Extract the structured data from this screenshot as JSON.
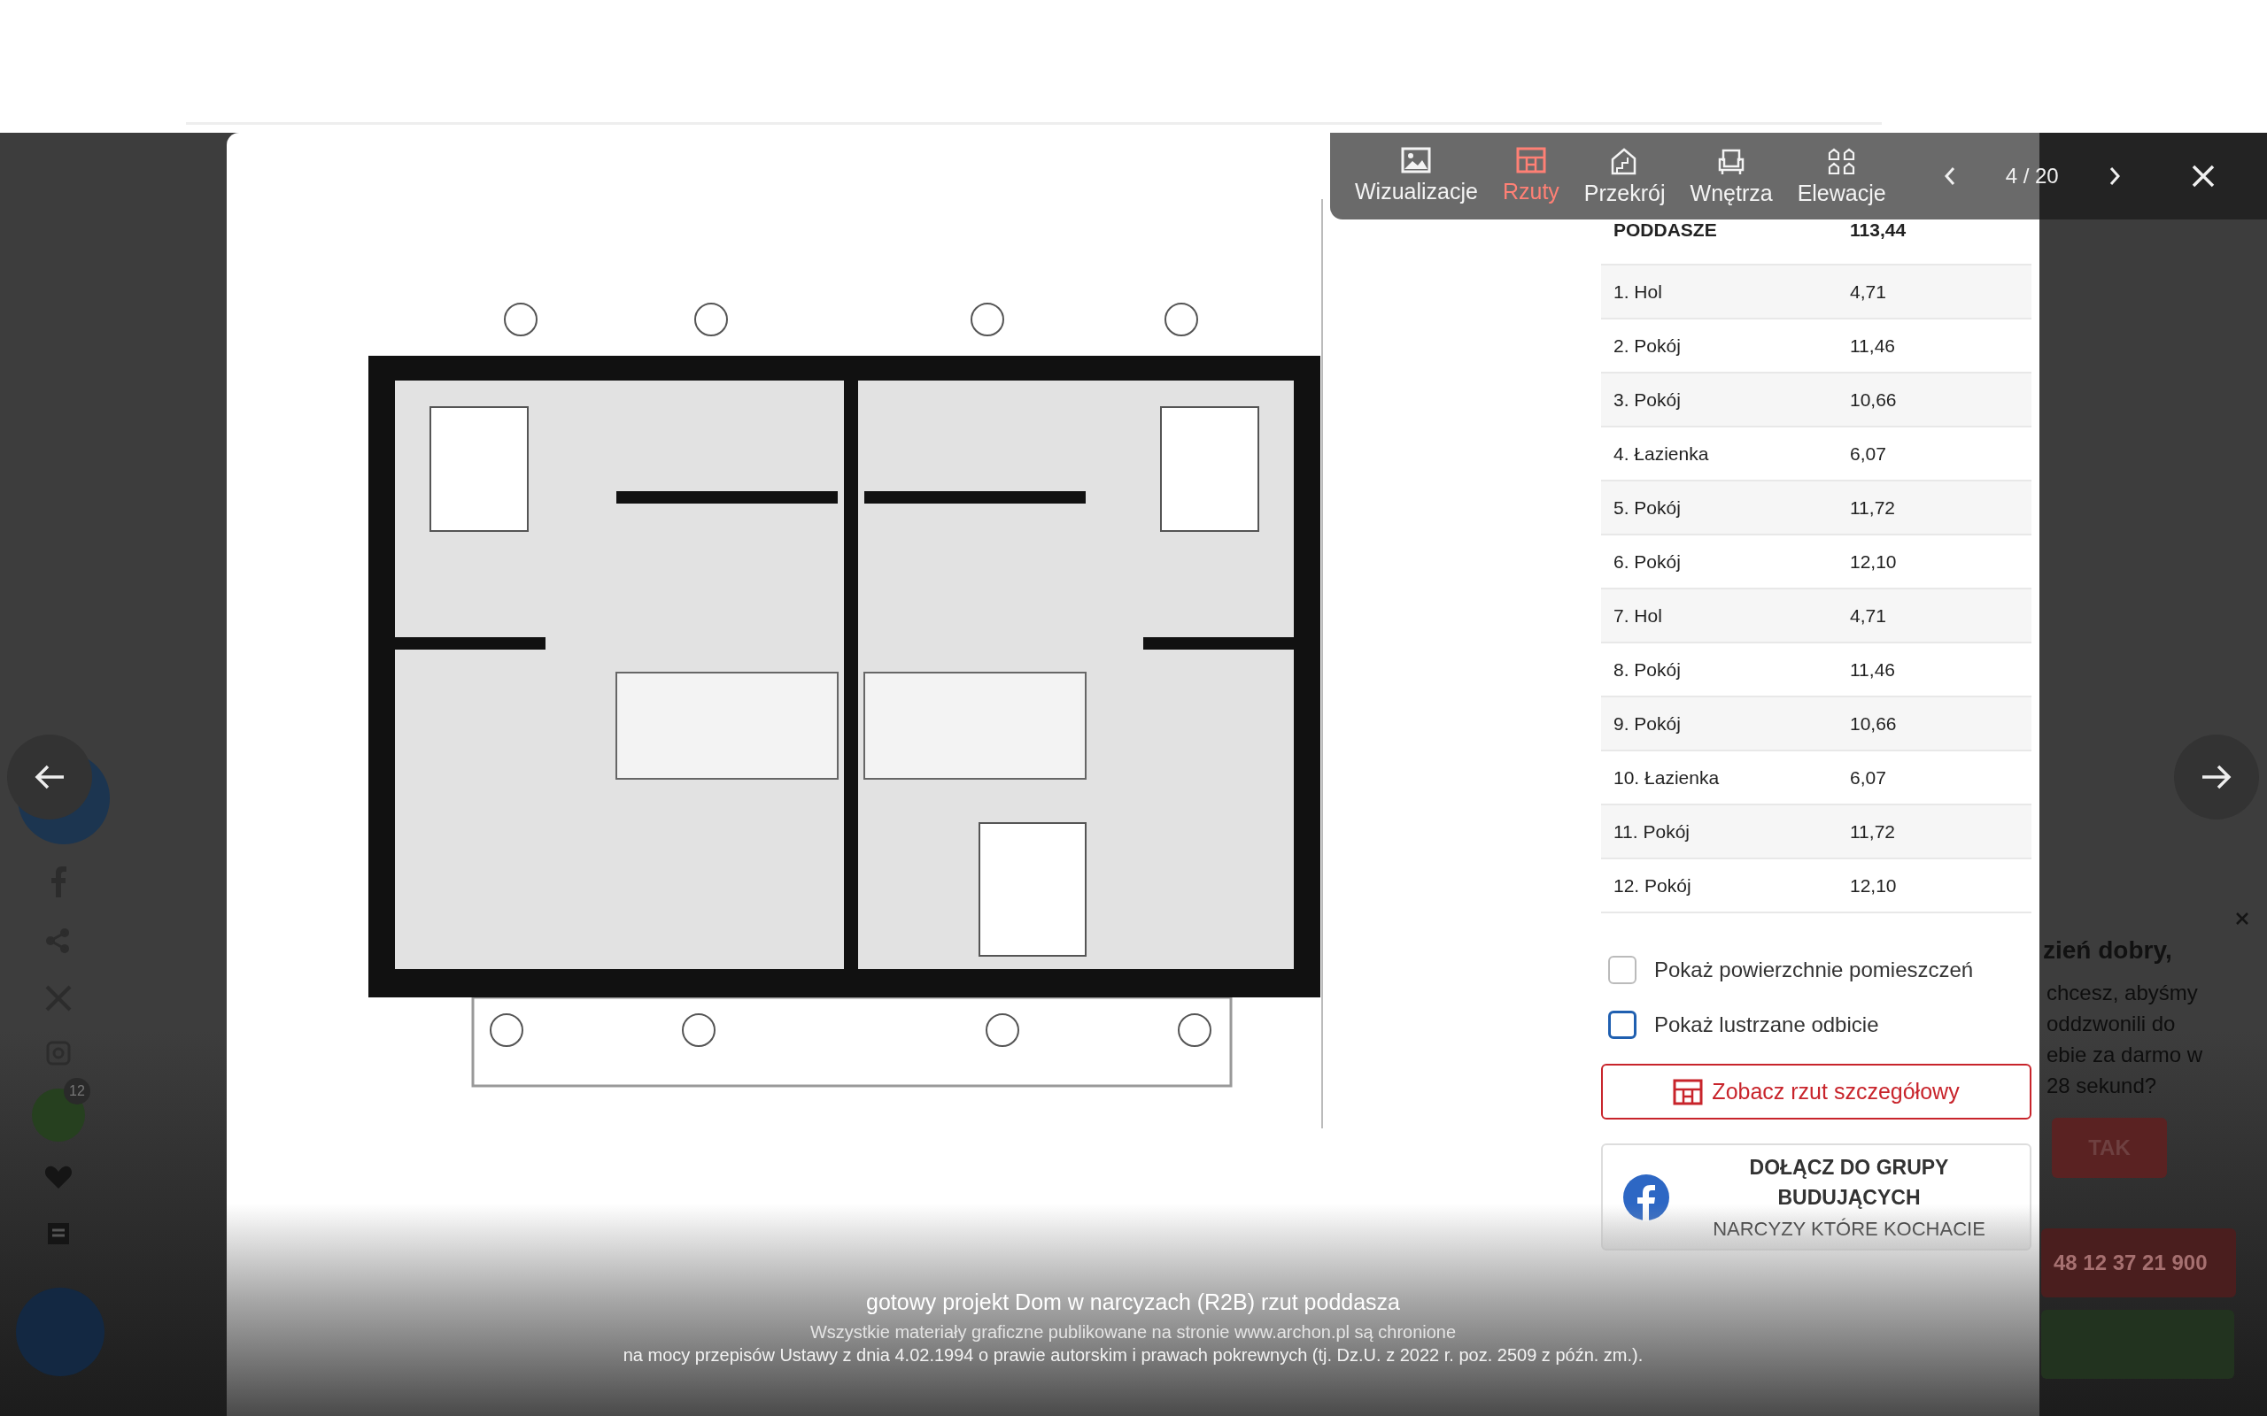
{
  "toolbar": {
    "tabs": [
      {
        "label": "Wizualizacje",
        "selected": false
      },
      {
        "label": "Rzuty",
        "selected": true
      },
      {
        "label": "Przekrój",
        "selected": false
      },
      {
        "label": "Wnętrza",
        "selected": false
      },
      {
        "label": "Elewacje",
        "selected": false
      }
    ],
    "counter": "4 / 20"
  },
  "area_table": {
    "header": {
      "name": "PODDASZE",
      "value": "113,44"
    },
    "rows": [
      {
        "name": "1. Hol",
        "value": "4,71"
      },
      {
        "name": "2. Pokój",
        "value": "11,46"
      },
      {
        "name": "3. Pokój",
        "value": "10,66"
      },
      {
        "name": "4. Łazienka",
        "value": "6,07"
      },
      {
        "name": "5. Pokój",
        "value": "11,72"
      },
      {
        "name": "6. Pokój",
        "value": "12,10"
      },
      {
        "name": "7. Hol",
        "value": "4,71"
      },
      {
        "name": "8. Pokój",
        "value": "11,46"
      },
      {
        "name": "9. Pokój",
        "value": "10,66"
      },
      {
        "name": "10. Łazienka",
        "value": "6,07"
      },
      {
        "name": "11. Pokój",
        "value": "11,72"
      },
      {
        "name": "12. Pokój",
        "value": "12,10"
      }
    ]
  },
  "options": [
    {
      "label": "Pokaż powierzchnie pomieszczeń",
      "checked": false,
      "focused": false
    },
    {
      "label": "Pokaż lustrzane odbicie",
      "checked": false,
      "focused": true
    }
  ],
  "detail_button": "Zobacz rzut szczegółowy",
  "facebook_card": {
    "title": "DOŁĄCZ DO GRUPY BUDUJĄCYCH",
    "subtitle": "NARCYZY KTÓRE KOCHACIE"
  },
  "caption": {
    "title": "gotowy projekt Dom w narcyzach (R2B) rzut poddasza",
    "lines": [
      "Wszystkie materiały graficzne publikowane na stronie www.archon.pl są chronione",
      "na mocy przepisów Ustawy z dnia 4.02.1994 o prawie autorskim i prawach pokrewnych (tj. Dz.U. z 2022 r. poz. 2509 z późn. zm.)."
    ]
  },
  "background": {
    "sidebar_badge": "12",
    "chat": {
      "greeting": "zień dobry,",
      "lines": [
        "chcesz, abyśmy",
        "oddzwonili do",
        "ebie za darmo w",
        "28 sekund?"
      ],
      "button": "TAK",
      "phone": "48 12 37 21 900"
    }
  }
}
